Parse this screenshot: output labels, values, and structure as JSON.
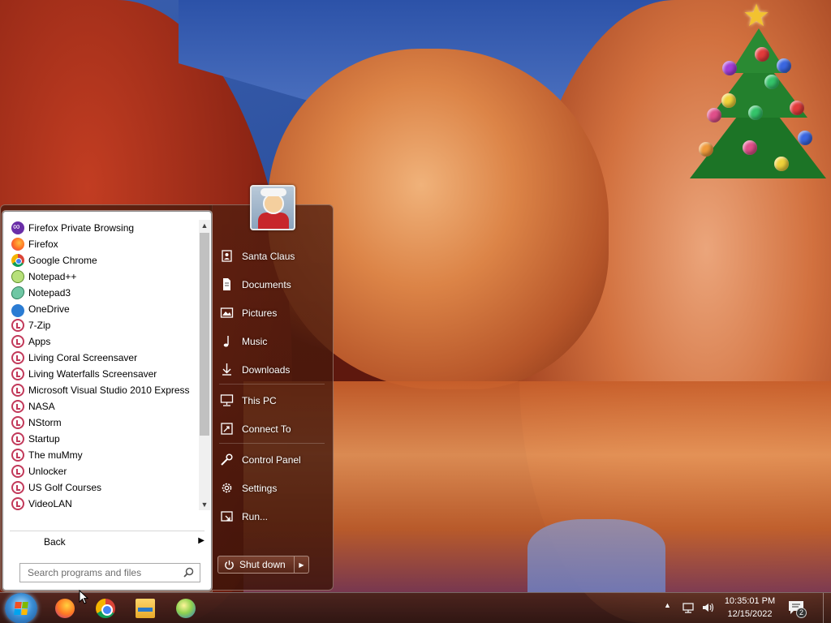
{
  "start_menu": {
    "programs": [
      {
        "label": "Firefox Private Browsing",
        "icon": "firefox-private-icon"
      },
      {
        "label": "Firefox",
        "icon": "firefox-icon"
      },
      {
        "label": "Google Chrome",
        "icon": "chrome-icon"
      },
      {
        "label": "Notepad++",
        "icon": "notepadpp-icon"
      },
      {
        "label": "Notepad3",
        "icon": "notepad3-icon"
      },
      {
        "label": "OneDrive",
        "icon": "onedrive-icon"
      },
      {
        "label": "7-Zip",
        "icon": "folder-icon"
      },
      {
        "label": "Apps",
        "icon": "folder-icon"
      },
      {
        "label": "Living Coral Screensaver",
        "icon": "folder-icon"
      },
      {
        "label": "Living Waterfalls Screensaver",
        "icon": "folder-icon"
      },
      {
        "label": "Microsoft Visual Studio 2010 Express",
        "icon": "folder-icon"
      },
      {
        "label": "NASA",
        "icon": "folder-icon"
      },
      {
        "label": "NStorm",
        "icon": "folder-icon"
      },
      {
        "label": "Startup",
        "icon": "folder-icon"
      },
      {
        "label": "The muMmy",
        "icon": "folder-icon"
      },
      {
        "label": "Unlocker",
        "icon": "folder-icon"
      },
      {
        "label": "US Golf Courses",
        "icon": "folder-icon"
      },
      {
        "label": "VideoLAN",
        "icon": "folder-icon"
      }
    ],
    "back_label": "Back",
    "search_placeholder": "Search programs and files",
    "right_items": [
      {
        "label": "Santa Claus",
        "icon": "user-folder-icon"
      },
      {
        "label": "Documents",
        "icon": "documents-icon"
      },
      {
        "label": "Pictures",
        "icon": "pictures-icon"
      },
      {
        "label": "Music",
        "icon": "music-icon"
      },
      {
        "label": "Downloads",
        "icon": "downloads-icon"
      },
      {
        "label": "This PC",
        "icon": "computer-icon"
      },
      {
        "label": "Connect To",
        "icon": "connect-icon"
      },
      {
        "label": "Control Panel",
        "icon": "wrench-icon"
      },
      {
        "label": "Settings",
        "icon": "gear-icon"
      },
      {
        "label": "Run...",
        "icon": "run-icon"
      }
    ],
    "shutdown_label": "Shut down"
  },
  "taskbar": {
    "pinned": [
      "start-orb-icon",
      "firefox-icon",
      "chrome-icon",
      "file-explorer-icon",
      "browser-globe-icon"
    ],
    "clock_time": "10:35:01 PM",
    "clock_date": "12/15/2022",
    "notification_count": "2"
  },
  "colors": {
    "menu_dark": "#46190c",
    "list_bg": "#ffffff",
    "folder_icon": "#c2395a"
  }
}
